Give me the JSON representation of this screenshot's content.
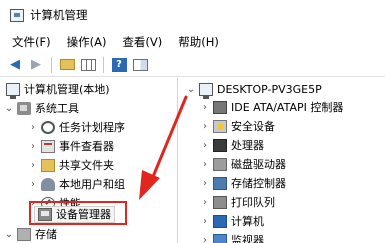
{
  "window": {
    "title": "计算机管理"
  },
  "menu": [
    "文件(F)",
    "操作(A)",
    "查看(V)",
    "帮助(H)"
  ],
  "toolbar": {
    "back_icon": "back-arrow-icon",
    "forward_icon": "forward-arrow-icon",
    "up_icon": "folder-up-icon",
    "view_icon": "console-tree-icon",
    "help_icon": "help-icon",
    "panel_icon": "action-pane-icon",
    "help_glyph": "?"
  },
  "left_tree": {
    "root": "计算机管理(本地)",
    "system_tools": "系统工具",
    "children": [
      "任务计划程序",
      "事件查看器",
      "共享文件夹",
      "本地用户和组",
      "性能",
      "设备管理器"
    ],
    "storage": "存储"
  },
  "right_tree": {
    "root": "DESKTOP-PV3GE5P",
    "items": [
      "IDE ATA/ATAPI 控制器",
      "安全设备",
      "处理器",
      "磁盘驱动器",
      "存储控制器",
      "打印队列",
      "计算机",
      "监视器"
    ]
  },
  "colors": {
    "annotation": "#e0261f",
    "accent_blue": "#2c68b3"
  }
}
